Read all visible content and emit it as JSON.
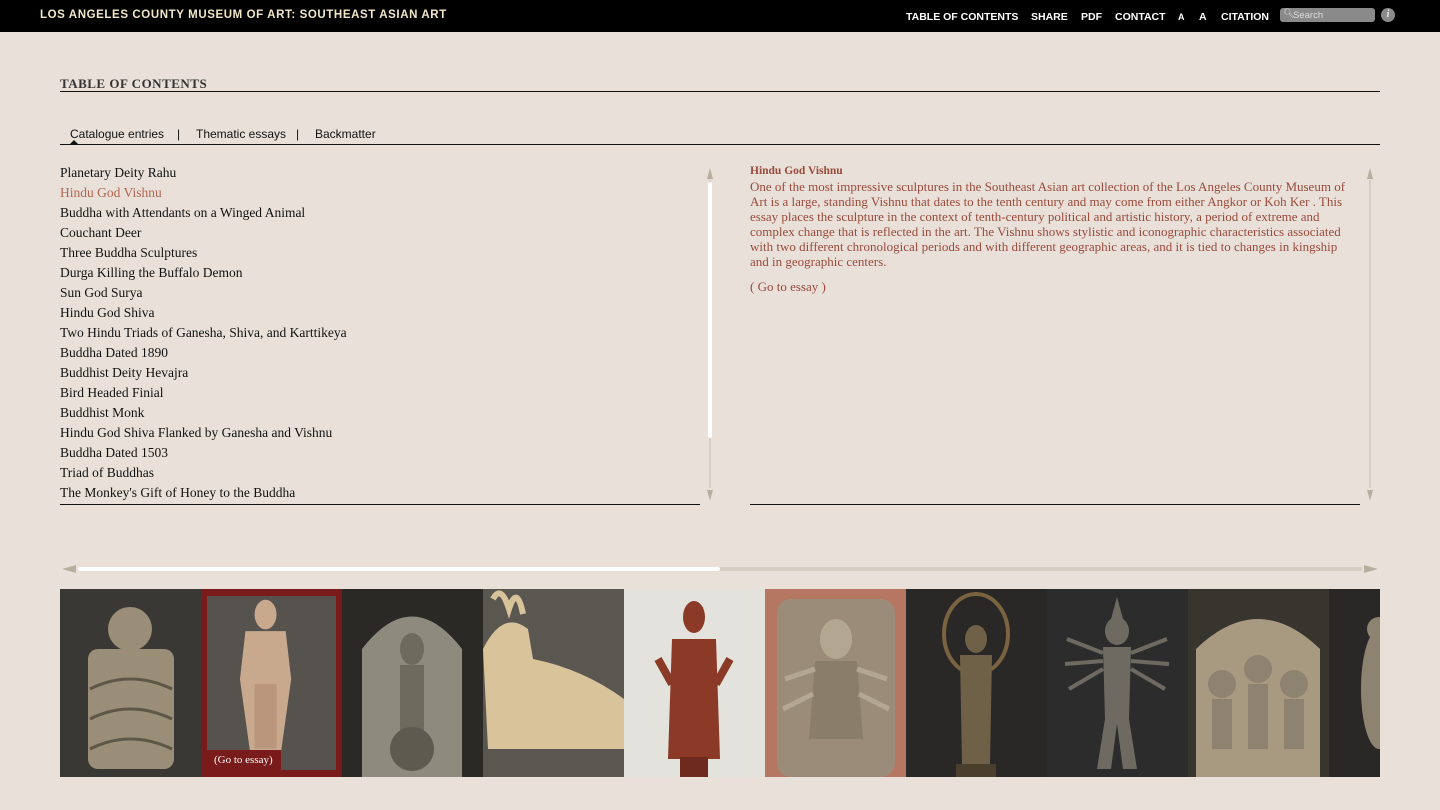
{
  "header": {
    "site_title": "LOS ANGELES COUNTY MUSEUM OF ART: SOUTHEAST ASIAN ART",
    "nav": [
      "TABLE OF CONTENTS",
      "SHARE",
      "PDF",
      "CONTACT",
      "A",
      "A",
      "CITATION"
    ],
    "search_placeholder": "Search",
    "info_icon": "i"
  },
  "toc": {
    "heading": "TABLE OF CONTENTS",
    "tabs": [
      "Catalogue entries",
      "Thematic essays",
      "Backmatter"
    ],
    "tab_separator": "|",
    "active_tab": "Catalogue entries",
    "entries": [
      "Planetary Deity Rahu",
      "Hindu God Vishnu",
      "Buddha with Attendants on a Winged Animal",
      "Couchant Deer",
      "Three Buddha Sculptures",
      "Durga Killing the Buffalo Demon",
      "Sun God Surya",
      "Hindu God Shiva",
      "Two Hindu Triads of Ganesha, Shiva, and Karttikeya",
      "Buddha Dated 1890",
      "Buddhist Deity Hevajra",
      "Bird Headed Finial",
      "Buddhist Monk",
      "Hindu God Shiva Flanked by Ganesha and Vishnu",
      "Buddha Dated 1503",
      "Triad of Buddhas",
      "The Monkey's Gift of Honey to the Buddha"
    ],
    "active_entry": "Hindu God Vishnu"
  },
  "detail": {
    "title": "Hindu God Vishnu",
    "body": "One of the most impressive sculptures in the Southeast Asian art collection of the Los Angeles County Museum of Art is a large, standing Vishnu that dates to the tenth century and may come from either Angkor or Koh Ker . This essay places the sculpture in the context of tenth-century political and artistic history, a period of extreme and complex change that is reflected in the art. The Vishnu shows stylistic and iconographic characteristics associated with two different chronological periods and with different geographic areas, and it is tied to changes in kingship and in geographic centers.",
    "link": "( Go to essay )"
  },
  "filmstrip": {
    "badge": "(Go to essay)",
    "selected_index": 1,
    "scroll_position": 0.5,
    "thumbnails": [
      {
        "subject": "rahu-sculpture-thumbnail",
        "bg": "#3a3834",
        "fg": "#9a8e78"
      },
      {
        "subject": "vishnu-sculpture-thumbnail",
        "bg": "#56524e",
        "fg": "#c9a98e"
      },
      {
        "subject": "buddha-attendants-thumbnail",
        "bg": "#2b2926",
        "fg": "#8e8a7e"
      },
      {
        "subject": "couchant-deer-thumbnail",
        "bg": "#5a5650",
        "fg": "#d8c39a"
      },
      {
        "subject": "standing-buddha-thumbnail",
        "bg": "#e4e2dc",
        "fg": "#8a3a26"
      },
      {
        "subject": "durga-relief-thumbnail",
        "bg": "#b57761",
        "fg": "#9a8c78"
      },
      {
        "subject": "surya-bronze-thumbnail",
        "bg": "#2a2826",
        "fg": "#6f6048"
      },
      {
        "subject": "hevajra-bronze-thumbnail",
        "bg": "#2c2c2c",
        "fg": "#6e6a62"
      },
      {
        "subject": "ganesha-triad-thumbnail",
        "bg": "#38352f",
        "fg": "#a89a80"
      },
      {
        "subject": "partial-sculpture-thumbnail",
        "bg": "#2a2826",
        "fg": "#8e8270"
      }
    ]
  }
}
